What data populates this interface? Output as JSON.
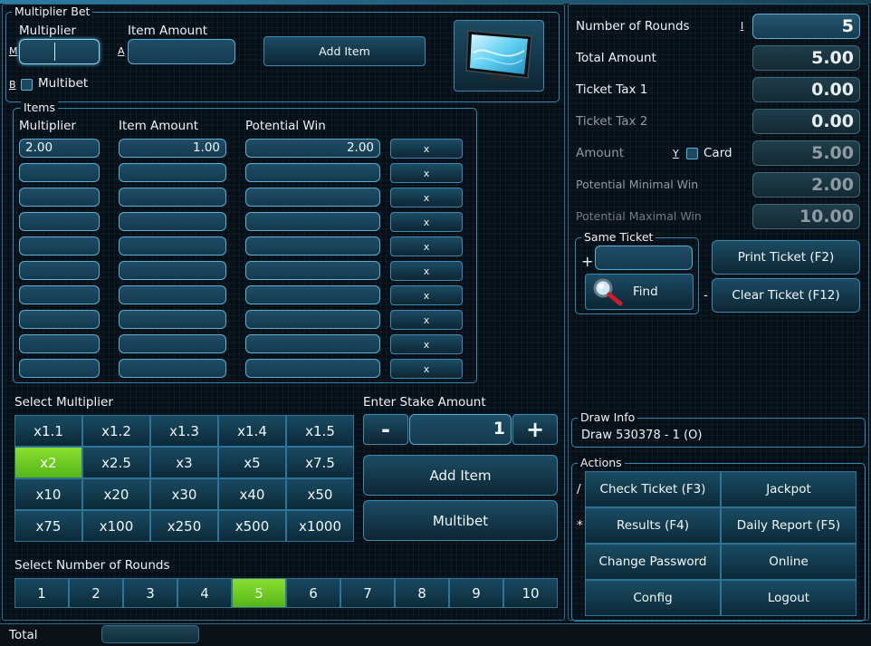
{
  "multiplier_bet": {
    "legend": "Multiplier Bet",
    "multiplier_label": "Multiplier",
    "item_amount_label": "Item Amount",
    "m_hotkey": "M",
    "a_hotkey": "A",
    "b_hotkey": "B",
    "multiplier_value": "",
    "item_amount_value": "",
    "add_item_label": "Add Item",
    "multibet_label": "Multibet"
  },
  "items": {
    "legend": "Items",
    "headers": [
      "Multiplier",
      "Item Amount",
      "Potential Win"
    ],
    "remove_label": "x",
    "rows": [
      {
        "multiplier": "2.00",
        "amount": "1.00",
        "win": "2.00"
      },
      {
        "multiplier": "",
        "amount": "",
        "win": ""
      },
      {
        "multiplier": "",
        "amount": "",
        "win": ""
      },
      {
        "multiplier": "",
        "amount": "",
        "win": ""
      },
      {
        "multiplier": "",
        "amount": "",
        "win": ""
      },
      {
        "multiplier": "",
        "amount": "",
        "win": ""
      },
      {
        "multiplier": "",
        "amount": "",
        "win": ""
      },
      {
        "multiplier": "",
        "amount": "",
        "win": ""
      },
      {
        "multiplier": "",
        "amount": "",
        "win": ""
      },
      {
        "multiplier": "",
        "amount": "",
        "win": ""
      }
    ]
  },
  "select_multiplier": {
    "label": "Select Multiplier",
    "options": [
      "x1.1",
      "x1.2",
      "x1.3",
      "x1.4",
      "x1.5",
      "x2",
      "x2.5",
      "x3",
      "x5",
      "x7.5",
      "x10",
      "x20",
      "x30",
      "x40",
      "x50",
      "x75",
      "x100",
      "x250",
      "x500",
      "x1000"
    ],
    "selected": "x2"
  },
  "stake": {
    "label": "Enter Stake Amount",
    "minus": "-",
    "plus": "+",
    "value": "1",
    "add_item": "Add Item",
    "multibet": "Multibet"
  },
  "rounds": {
    "label": "Select Number of Rounds",
    "options": [
      "1",
      "2",
      "3",
      "4",
      "5",
      "6",
      "7",
      "8",
      "9",
      "10"
    ],
    "selected": "5"
  },
  "footer": {
    "total_label": "Total"
  },
  "summary": {
    "number_of_rounds_label": "Number of Rounds",
    "rounds_hotkey": "I",
    "number_of_rounds": "5",
    "total_amount_label": "Total Amount",
    "total_amount": "5.00",
    "ticket_tax1_label": "Ticket Tax 1",
    "ticket_tax1": "0.00",
    "ticket_tax2_label": "Ticket Tax 2",
    "ticket_tax2": "0.00",
    "amount_label": "Amount",
    "card_hotkey": "Y",
    "card_label": "Card",
    "amount": "5.00",
    "min_win_label": "Potential Minimal Win",
    "min_win": "2.00",
    "max_win_label": "Potential Maximal Win",
    "max_win": "10.00"
  },
  "same_ticket": {
    "legend": "Same Ticket",
    "plus": "+",
    "input_value": "",
    "find_label": "Find",
    "minus": "-"
  },
  "ticket_buttons": {
    "print": "Print Ticket (F2)",
    "clear": "Clear Ticket (F12)"
  },
  "draw_info": {
    "legend": "Draw Info",
    "value": "Draw 530378 - 1 (O)"
  },
  "actions": {
    "legend": "Actions",
    "slash": "/",
    "star": "*",
    "buttons": [
      "Check Ticket (F3)",
      "Jackpot",
      "Results (F4)",
      "Daily Report (F5)",
      "Change Password",
      "Online",
      "Config",
      "Logout"
    ]
  }
}
